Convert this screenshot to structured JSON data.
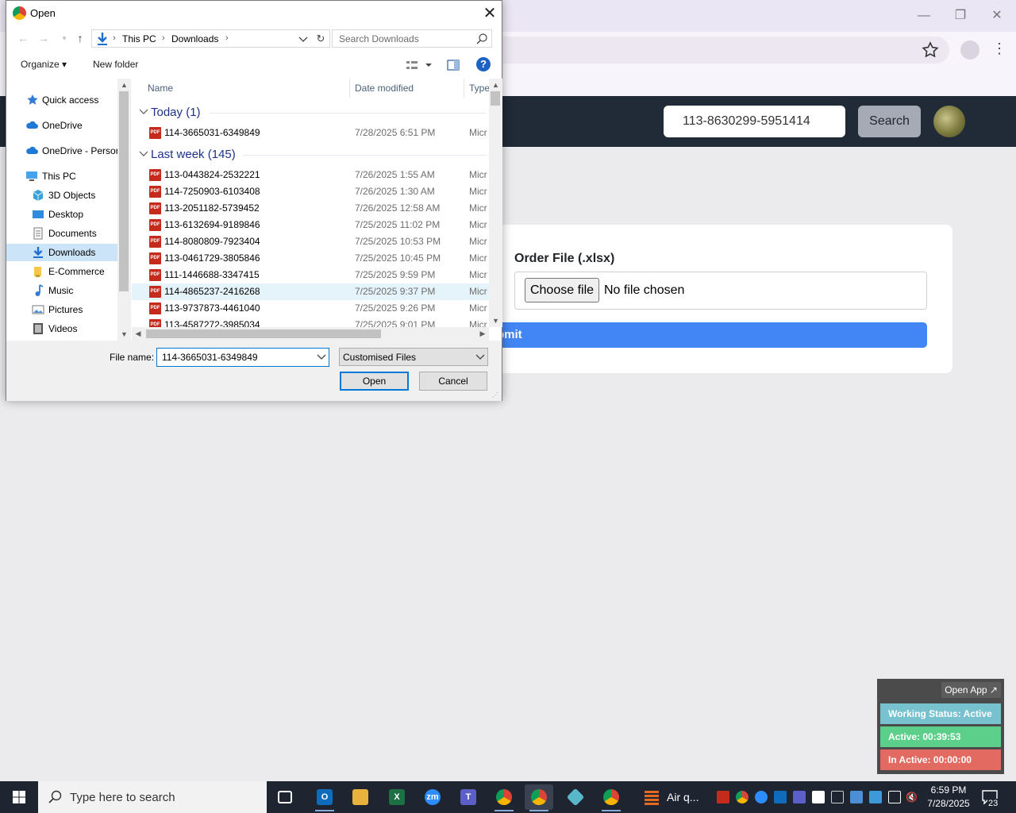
{
  "browser": {
    "header": {
      "search_value": "113-8630299-5951414",
      "search_button": "Search"
    },
    "form": {
      "order_file_label": "Order File (.xlsx)",
      "choose_file_label": "Choose file",
      "no_file_text": "No file chosen",
      "submit_label": "bmit"
    }
  },
  "dialog": {
    "title": "Open",
    "close": "✕",
    "breadcrumb": [
      "This PC",
      "Downloads"
    ],
    "search_placeholder": "Search Downloads",
    "organize_label": "Organize ▾",
    "new_folder_label": "New folder",
    "help_label": "?",
    "nav": [
      {
        "label": "Quick access",
        "icon": "star-icon"
      },
      {
        "label": "OneDrive",
        "icon": "cloud-icon"
      },
      {
        "label": "OneDrive - Persor",
        "icon": "cloud-icon"
      },
      {
        "label": "This PC",
        "icon": "computer-icon"
      },
      {
        "label": "3D Objects",
        "icon": "cube-icon"
      },
      {
        "label": "Desktop",
        "icon": "desktop-icon"
      },
      {
        "label": "Documents",
        "icon": "documents-icon"
      },
      {
        "label": "Downloads",
        "icon": "download-icon",
        "selected": true
      },
      {
        "label": "E-Commerce",
        "icon": "folder-icon"
      },
      {
        "label": "Music",
        "icon": "music-icon"
      },
      {
        "label": "Pictures",
        "icon": "pictures-icon"
      },
      {
        "label": "Videos",
        "icon": "videos-icon"
      }
    ],
    "columns": {
      "name": "Name",
      "date": "Date modified",
      "type": "Type"
    },
    "groups": [
      {
        "label": "Today (1)",
        "files": [
          {
            "name": "114-3665031-6349849",
            "date": "7/28/2025 6:51 PM",
            "type": "Micr"
          }
        ]
      },
      {
        "label": "Last week (145)",
        "files": [
          {
            "name": "113-0443824-2532221",
            "date": "7/26/2025 1:55 AM",
            "type": "Micr"
          },
          {
            "name": "114-7250903-6103408",
            "date": "7/26/2025 1:30 AM",
            "type": "Micr"
          },
          {
            "name": "113-2051182-5739452",
            "date": "7/26/2025 12:58 AM",
            "type": "Micr"
          },
          {
            "name": "113-6132694-9189846",
            "date": "7/25/2025 11:02 PM",
            "type": "Micr"
          },
          {
            "name": "114-8080809-7923404",
            "date": "7/25/2025 10:53 PM",
            "type": "Micr"
          },
          {
            "name": "113-0461729-3805846",
            "date": "7/25/2025 10:45 PM",
            "type": "Micr"
          },
          {
            "name": "111-1446688-3347415",
            "date": "7/25/2025 9:59 PM",
            "type": "Micr"
          },
          {
            "name": "114-4865237-2416268",
            "date": "7/25/2025 9:37 PM",
            "type": "Micr",
            "highlighted": true
          },
          {
            "name": "113-9737873-4461040",
            "date": "7/25/2025 9:26 PM",
            "type": "Micr"
          },
          {
            "name": "113-4587272-3985034",
            "date": "7/25/2025 9:01 PM",
            "type": "Micr"
          }
        ]
      }
    ],
    "file_name_label": "File name:",
    "file_name_value": "114-3665031-6349849",
    "file_type_value": "Customised Files",
    "open_label": "Open",
    "cancel_label": "Cancel"
  },
  "widget": {
    "open_app": "Open App ↗",
    "working_status": "Working Status: Active",
    "active": "Active: 00:39:53",
    "inactive": "In Active: 00:00:00",
    "colors": {
      "status": "#78c2cf",
      "active": "#5cd08a",
      "inactive": "#e36a61"
    }
  },
  "taskbar": {
    "search_placeholder": "Type here to search",
    "air_quality_label": "Air q...",
    "time": "6:59 PM",
    "date": "7/28/2025",
    "notification_count": "23"
  }
}
